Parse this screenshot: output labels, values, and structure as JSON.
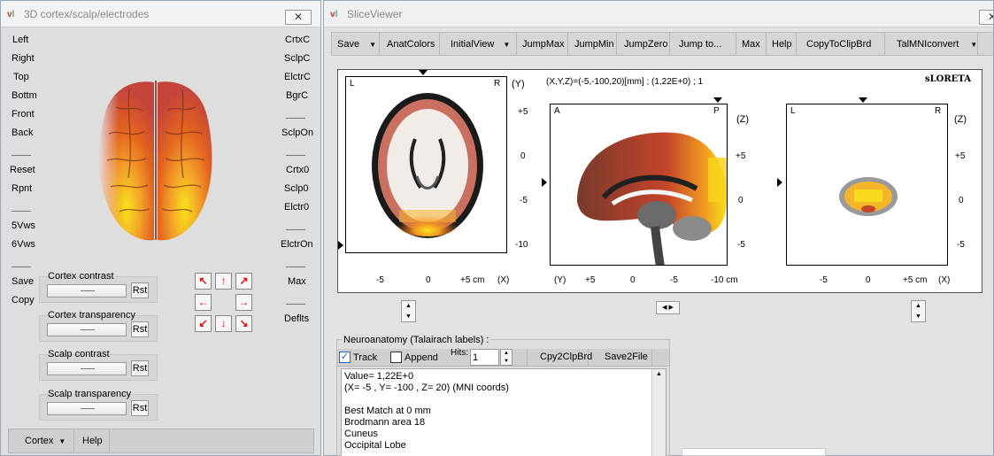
{
  "left_window": {
    "title": "3D cortex/scalp/electrodes",
    "close_glyph": "✕",
    "left_buttons": [
      "Left",
      "Right",
      "Top",
      "Bottm",
      "Front",
      "Back",
      "Reset",
      "Rpnt",
      "5Vws",
      "6Vws",
      "Save",
      "Copy"
    ],
    "right_buttons": [
      "CrtxC",
      "SclpC",
      "ElctrC",
      "BgrC",
      "SclpOn",
      "Crtx0",
      "Sclp0",
      "Elctr0",
      "ElctrOn",
      "Max",
      "Deflts"
    ],
    "sliders": [
      {
        "label": "Cortex contrast",
        "button": "Rst"
      },
      {
        "label": "Cortex transparency",
        "button": "Rst"
      },
      {
        "label": "Scalp contrast",
        "button": "Rst"
      },
      {
        "label": "Scalp transparency",
        "button": "Rst"
      }
    ],
    "arrows": [
      "↖",
      "↑",
      "↗",
      "←",
      "→",
      "↙",
      "↓",
      "↘"
    ],
    "bottom": {
      "cortex_label": "Cortex",
      "help_label": "Help"
    }
  },
  "right_window": {
    "title": "SliceViewer",
    "close_glyph": "✕",
    "toolbar": {
      "save": "Save",
      "anat_colors": "AnatColors",
      "initial_view": "InitialView",
      "jump_max": "JumpMax",
      "jump_min": "JumpMin",
      "jump_zero": "JumpZero",
      "jump_to": "Jump to...",
      "max": "Max",
      "help": "Help",
      "copy_to_clipbrd": "CopyToClipBrd",
      "talmni_convert": "TalMNIconvert"
    },
    "coords_text": "(X,Y,Z)=(-5,-100,20)[mm]  ;  (1,22E+0)  ;  1",
    "method_label": "sLORETA",
    "axial": {
      "corner_left": "L",
      "corner_right": "R",
      "axis_label": "(Y)",
      "y_ticks": [
        "+5",
        "0",
        "-5",
        "-10"
      ],
      "x_ticks": [
        "-5",
        "0",
        "+5 cm"
      ],
      "x_axis_label": "(X)"
    },
    "sagittal": {
      "corner_left": "A",
      "corner_right": "P",
      "axis_label": "(Z)",
      "y_ticks": [
        "+5",
        "0",
        "-5"
      ],
      "x_ticks": [
        "+5",
        "0",
        "-5",
        "-10 cm"
      ],
      "x_axis_label": "(Y)"
    },
    "coronal": {
      "corner_left": "L",
      "corner_right": "R",
      "axis_label": "(Z)",
      "y_ticks": [
        "+5",
        "0",
        "-5"
      ],
      "x_ticks": [
        "-5",
        "0",
        "+5 cm"
      ],
      "x_axis_label": "(X)"
    }
  },
  "neuroanatomy": {
    "title": "Neuroanatomy (Talairach labels) :",
    "track_label": "Track",
    "track_checked": true,
    "append_label": "Append",
    "append_checked": false,
    "hits_label": "Hits:",
    "hits_value": "1",
    "copy_button": "Cpy2ClpBrd",
    "save_button": "Save2File",
    "lines": [
      "Value= 1,22E+0",
      "(X= -5 , Y= -100 , Z= 20) (MNI coords)",
      "",
      "Best Match at 0 mm",
      "Brodmann area 18",
      "Cuneus",
      "Occipital Lobe",
      "-----------"
    ]
  },
  "colors": {
    "heat_high": "#f7e21a",
    "heat_mid": "#e4651e",
    "heat_low": "#a3281c",
    "accent_check": "#1c64c8"
  }
}
